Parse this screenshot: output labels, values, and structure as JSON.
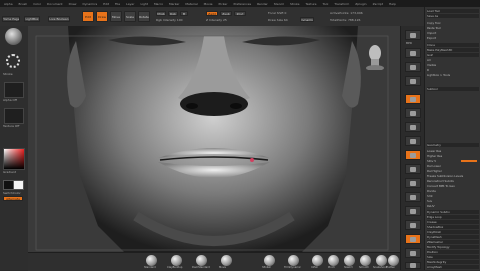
{
  "menubar": {
    "items": [
      "Alpha",
      "Brush",
      "Color",
      "Document",
      "Draw",
      "Dynamics",
      "Edit",
      "File",
      "Layer",
      "Light",
      "Macro",
      "Marker",
      "Material",
      "Movie",
      "Picker",
      "Preferences",
      "Render",
      "Stencil",
      "Stroke",
      "Texture",
      "Tool",
      "Transform",
      "Zplugin",
      "Zscript",
      "Help"
    ]
  },
  "topshelf": {
    "home_page": "Home Page",
    "lightbox": "LightBox",
    "live_boolean": "Live Boolean",
    "edit": "Edit",
    "draw": "Draw",
    "move": "Move",
    "scale": "Scale",
    "rotate": "Rotate",
    "mrgb": "Mrgb",
    "rgb": "Rgb",
    "m": "M",
    "zadd": "Zadd",
    "zsub": "Zsub",
    "zcut": "Zcut",
    "focal_shift": "Focal Shift 0",
    "draw_size": "Draw Size 64",
    "dynamic": "Dynamic",
    "rgb_intensity": "Rgb Intensity 100",
    "z_intensity": "Z Intensity 25",
    "active_points": "ActivePoints: 173,996",
    "total_points": "TotalPoints: 788,126"
  },
  "lefttray": {
    "stroke_label": "Stroke",
    "alpha_label": "Alpha Off",
    "texture_label": "Texture Off",
    "gradient_label": "Gradient",
    "switch_color_label": "SwitchColor",
    "alternate_label": "Alternate"
  },
  "righttools": [
    "BPR",
    "SPix",
    "Scroll",
    "Zoom",
    "Actual",
    "AAHalf",
    "Persp",
    "Floor",
    "Local",
    "Frame",
    "Move",
    "Scale",
    "Rotate",
    "Line Fill",
    "PolyF",
    "Transp",
    "Solo",
    "Xpose"
  ],
  "rightpanel": {
    "rows": [
      "Load Tool",
      "Save As",
      "Copy Tool",
      "Paste Tool",
      "Import",
      "Export",
      "Clone",
      "Make PolyMesh3D",
      "GoZ",
      "All",
      "Visible",
      "R",
      "Lightbox > Tools",
      "Subtool",
      "Geometry",
      "Lower Res",
      "Higher Res",
      "SDiv 5",
      "Del Lower",
      "Del Higher",
      "Freeze SubDivision Levels",
      "Reconstruct Subdiv",
      "Convert BPR To Geo",
      "Divide",
      "Smt",
      "Suv",
      "ReUV",
      "Dynamic Subdiv",
      "Edge Loop",
      "Crease",
      "ShadowBox",
      "ClayPolish",
      "DynaMesh",
      "ZRemesher",
      "Modify Topology",
      "Position",
      "Size",
      "MeshIntegrity",
      "ArrayMesh",
      "NanoMesh",
      "Thick Skin",
      "Layers"
    ]
  },
  "bottomshelf": {
    "brushes": [
      "Standard",
      "ClayBuildup",
      "DamStandard",
      "Move",
      "hPolish",
      "TrimDynamic",
      "Inflat",
      "Pinch",
      "Slash3",
      "Smooth",
      "Snakehook",
      "Flatten"
    ]
  },
  "colors": {
    "accent": "#e8731a",
    "bg": "#2a2a2a",
    "panel": "#333333"
  }
}
